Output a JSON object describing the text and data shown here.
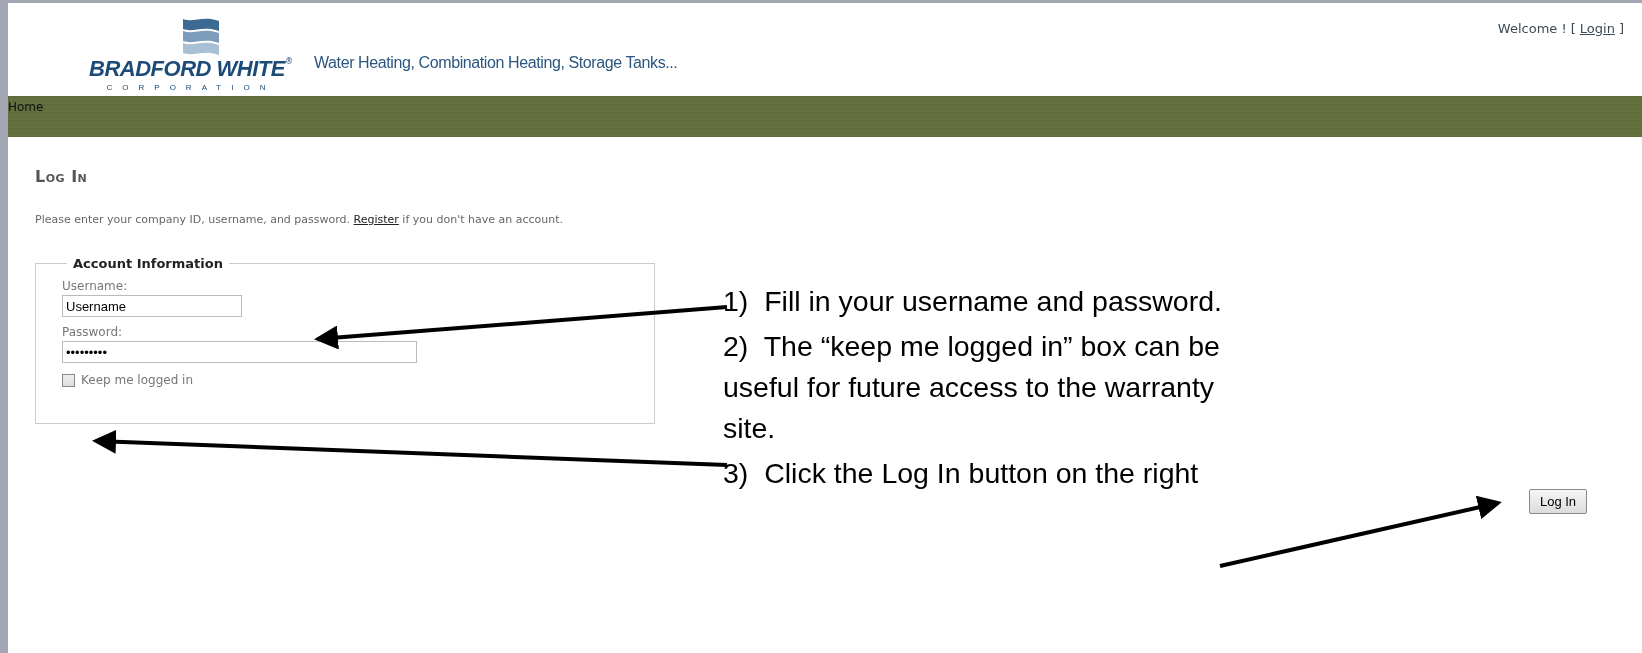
{
  "header": {
    "logo": {
      "name": "BRADFORD WHITE",
      "mark": "®",
      "subtitle": "CORPORATION"
    },
    "tagline": "Water Heating, Combination Heating, Storage Tanks...",
    "welcome": "Welcome ! [",
    "login_link": "Login",
    "welcome_end": "]"
  },
  "nav": [
    {
      "label": "Home"
    }
  ],
  "page": {
    "title": "Log In",
    "intro": "Please enter your company ID, username, and password.",
    "register_link": "Register",
    "intro_end": "if you don't have an account."
  },
  "account": {
    "legend": "Account Information",
    "fields": [
      {
        "label": "Username:",
        "value": "Username",
        "kind": "short"
      },
      {
        "label": "Password:",
        "value": "•••••••••",
        "kind": "long"
      }
    ],
    "keep_logged_in": {
      "label": "Keep me logged in",
      "checked": false
    }
  },
  "button": "Log In",
  "annotations": [
    "1)  Fill in your username and password.",
    "2)  The “keep me logged in” box can be useful for future access to the warranty site.",
    "3)  Click the Log In button on the right"
  ]
}
